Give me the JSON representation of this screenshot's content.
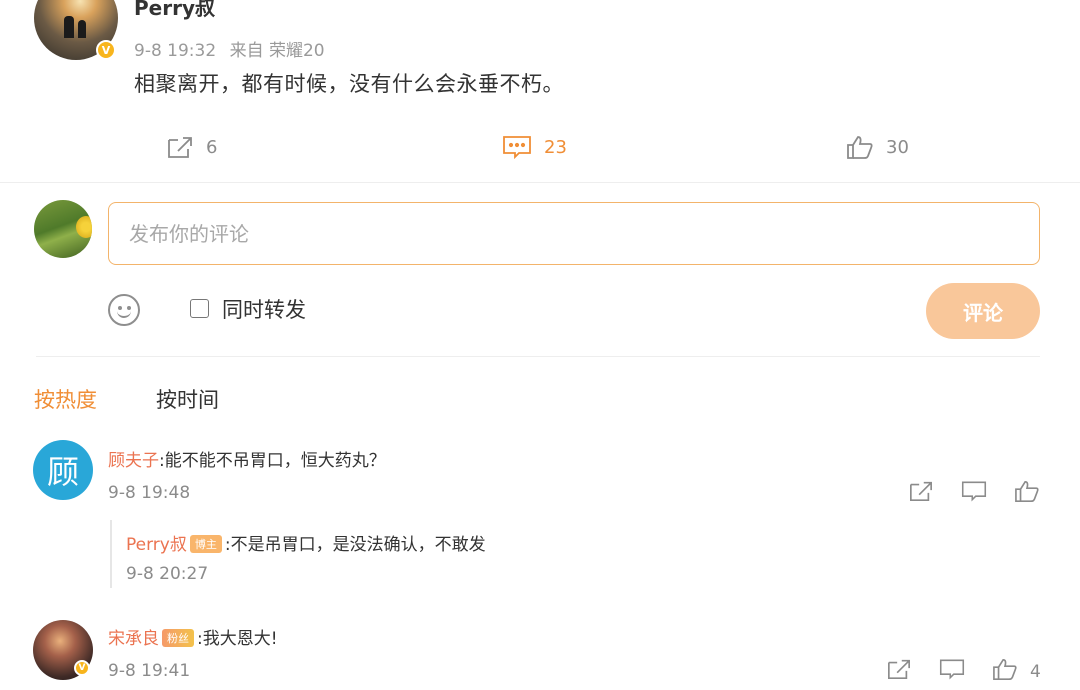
{
  "post": {
    "author": "Perry叔",
    "time": "9-8 19:32",
    "source": "来自 荣耀20",
    "text": "相聚离开，都有时候，没有什么会永垂不朽。",
    "share_count": "6",
    "comment_count": "23",
    "like_count": "30"
  },
  "compose": {
    "placeholder": "发布你的评论",
    "repost_label": "同时转发",
    "submit_label": "评论"
  },
  "sort_tabs": {
    "hot": "按热度",
    "time": "按时间"
  },
  "comments": [
    {
      "avatar_text": "顾",
      "author": "顾夫子",
      "text": ":能不能不吊胃口，恒大药丸？",
      "time": "9-8 19:48",
      "reply": {
        "author": "Perry叔",
        "tag": "博主",
        "text": ":不是吊胃口，是没法确认，不敢发",
        "time": "9-8 20:27"
      }
    },
    {
      "author": "宋承良",
      "tag": "粉丝",
      "text": ":我大恩大!",
      "time": "9-8 19:41",
      "like_count": "4"
    }
  ],
  "colors": {
    "accent": "#f08e36",
    "name": "#eb7350",
    "submit_bg": "#f9c79a",
    "input_border": "#f3b46b"
  },
  "icons": [
    "share-icon",
    "comment-icon",
    "like-icon",
    "emoji-icon",
    "verified-badge-icon"
  ]
}
